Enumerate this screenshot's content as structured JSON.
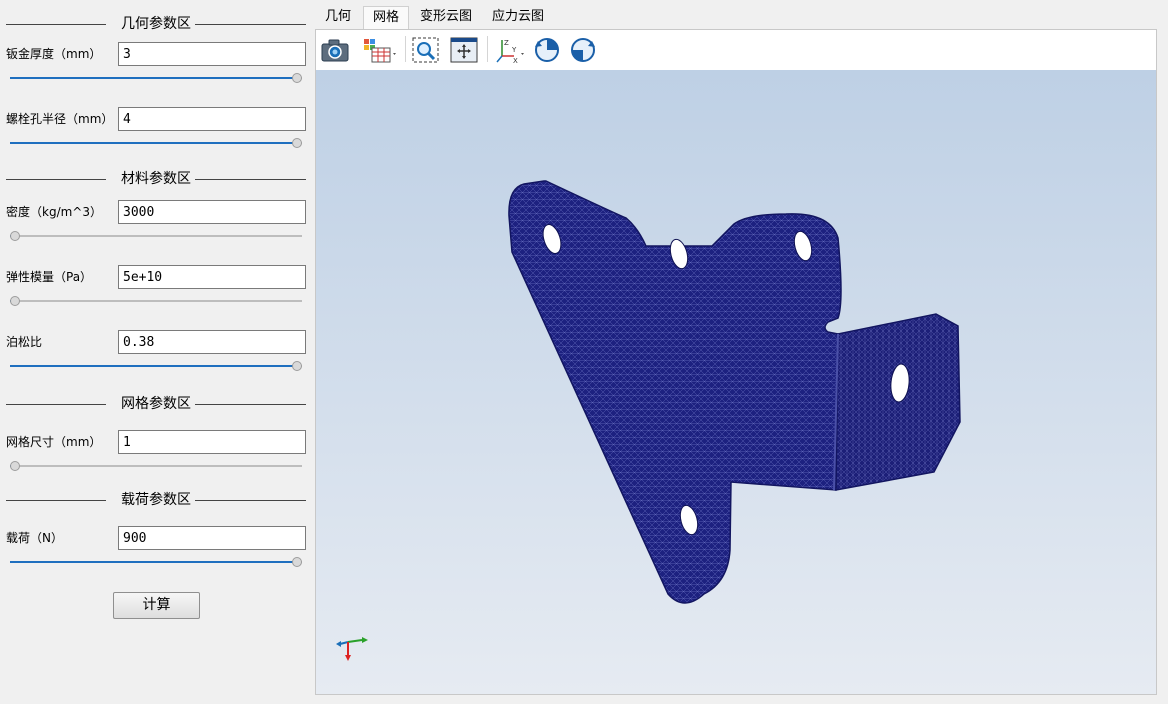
{
  "sections": {
    "geometry": "几何参数区",
    "material": "材料参数区",
    "mesh": "网格参数区",
    "load": "载荷参数区"
  },
  "fields": {
    "sheet_thickness": {
      "label": "钣金厚度（mm）",
      "value": "3",
      "slider_level": 1.0
    },
    "bolt_radius": {
      "label": "螺栓孔半径（mm）",
      "value": "4",
      "slider_level": 1.0
    },
    "density": {
      "label": "密度（kg/m^3）",
      "value": "3000",
      "slider_level": 0.0
    },
    "elastic_modulus": {
      "label": "弹性模量（Pa）",
      "value": "5e+10",
      "slider_level": 0.0
    },
    "poisson_ratio": {
      "label": "泊松比",
      "value": "0.38",
      "slider_level": 1.0
    },
    "mesh_size": {
      "label": "网格尺寸（mm）",
      "value": "1",
      "slider_level": 0.0
    },
    "load": {
      "label": "载荷（N）",
      "value": "900",
      "slider_level": 1.0
    }
  },
  "compute_button": "计算",
  "tabs": [
    {
      "label": "几何",
      "active": false
    },
    {
      "label": "网格",
      "active": true
    },
    {
      "label": "变形云图",
      "active": false
    },
    {
      "label": "应力云图",
      "active": false
    }
  ],
  "toolbar": {
    "icons": [
      "camera-icon",
      "display-mode-icon",
      "zoom-box-icon",
      "fit-all-icon",
      "view-axes-icon",
      "rotate-cw-icon",
      "rotate-ccw-icon"
    ]
  },
  "colors": {
    "accent": "#1f6fbf",
    "mesh": "#1d2180",
    "viewport_top": "#bed0e5",
    "viewport_bottom": "#e6ebf2"
  }
}
